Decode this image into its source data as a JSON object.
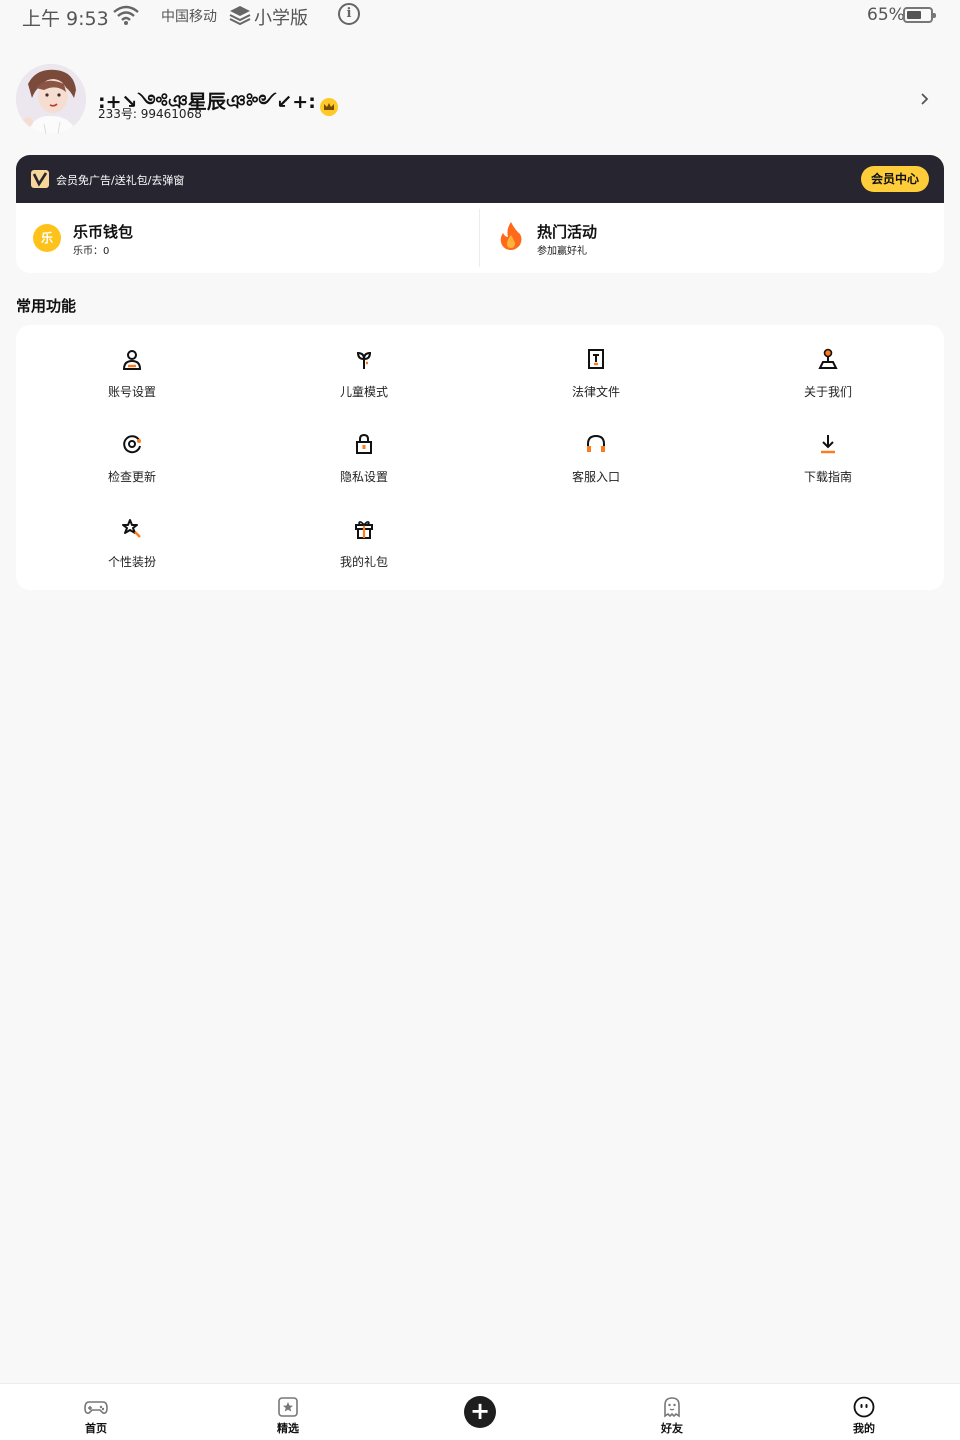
{
  "status_bar": {
    "time": "上午 9:53",
    "carrier": "中国移动",
    "app_name": "小学版",
    "battery": "65%",
    "battery_level": 0.65
  },
  "profile": {
    "nickname": ":+↘༺ঞ星辰ঞ༻↙+:",
    "uid": "233号: 99461068"
  },
  "member": {
    "promo_text": "会员免广告/送礼包/去弹窗",
    "center_button": "会员中心"
  },
  "wallet": {
    "title": "乐币钱包",
    "coin_glyph": "乐",
    "subtitle": "乐币：0"
  },
  "activity": {
    "title": "热门活动",
    "subtitle": "参加赢好礼"
  },
  "section_title": "常用功能",
  "functions": [
    {
      "label": "账号设置",
      "icon": "user-icon"
    },
    {
      "label": "儿童模式",
      "icon": "sprout-icon"
    },
    {
      "label": "法律文件",
      "icon": "document-icon"
    },
    {
      "label": "关于我们",
      "icon": "location-pin-icon"
    },
    {
      "label": "检查更新",
      "icon": "update-icon"
    },
    {
      "label": "隐私设置",
      "icon": "lock-icon"
    },
    {
      "label": "客服入口",
      "icon": "headset-icon"
    },
    {
      "label": "下载指南",
      "icon": "download-icon"
    },
    {
      "label": "个性装扮",
      "icon": "star-wand-icon"
    },
    {
      "label": "我的礼包",
      "icon": "gift-icon"
    }
  ],
  "bottom_nav": [
    {
      "label": "首页",
      "icon": "gamepad-icon"
    },
    {
      "label": "精选",
      "icon": "star-square-icon"
    },
    {
      "label": "",
      "icon": "plus-icon"
    },
    {
      "label": "好友",
      "icon": "ghost-icon"
    },
    {
      "label": "我的",
      "icon": "face-icon"
    }
  ],
  "colors": {
    "accent": "#ffcc3a",
    "vip_bar": "#272530",
    "orange": "#ff7a1a"
  }
}
